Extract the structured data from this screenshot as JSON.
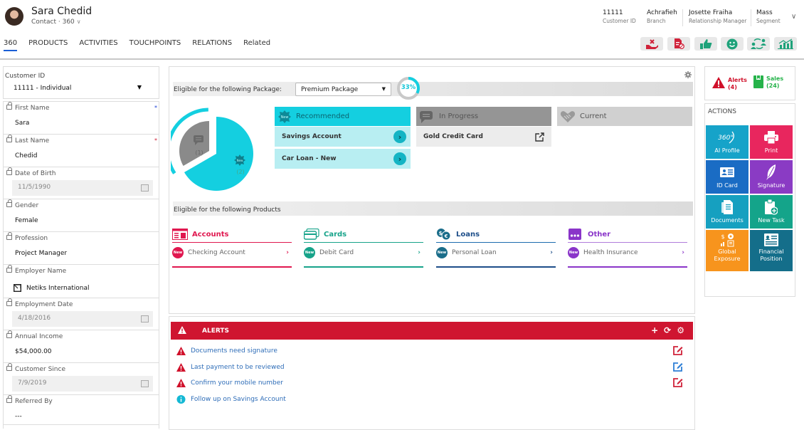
{
  "header": {
    "name": "Sara Chedid",
    "subtitle": "Contact · 360",
    "tabs": [
      "360",
      "PRODUCTS",
      "ACTIVITIES",
      "TOUCHPOINTS",
      "RELATIONS",
      "Related"
    ],
    "active_tab": "360",
    "fields": [
      {
        "value": "11111",
        "label": "Customer ID"
      },
      {
        "value": "Achrafieh",
        "label": "Branch"
      },
      {
        "value": "Josette Fraiha",
        "label": "Relationship Manager"
      },
      {
        "value": "Mass",
        "label": "Segment"
      }
    ],
    "quick_actions": [
      {
        "icon": "hand-cancel-icon",
        "color": "#d0223a"
      },
      {
        "icon": "document-blocked-icon",
        "color": "#d0223a"
      },
      {
        "icon": "thumbs-up-icon",
        "color": "#1ea27a"
      },
      {
        "icon": "smiley-icon",
        "color": "#1ea27a"
      },
      {
        "icon": "people-exchange-icon",
        "color": "#1ea27a"
      },
      {
        "icon": "growth-chart-icon",
        "color": "#1ea27a"
      }
    ]
  },
  "left": {
    "customer_id_label": "Customer ID",
    "customer_id_value": "11111 - Individual",
    "fields": [
      {
        "label": "First Name",
        "value": "Sara",
        "type": "text",
        "required": "blue"
      },
      {
        "label": "Last Name",
        "value": "Chedid",
        "type": "text",
        "required": "red"
      },
      {
        "label": "Date of Birth",
        "value": "11/5/1990",
        "type": "date"
      },
      {
        "label": "Gender",
        "value": "Female",
        "type": "text"
      },
      {
        "label": "Profession",
        "value": "Project Manager",
        "type": "text"
      },
      {
        "label": "Employer Name",
        "value": "Netiks International",
        "type": "lookup"
      },
      {
        "label": "Employment Date",
        "value": "4/18/2016",
        "type": "date"
      },
      {
        "label": "Annual Income",
        "value": "$54,000.00",
        "type": "text"
      },
      {
        "label": "Customer Since",
        "value": "7/9/2019",
        "type": "date"
      },
      {
        "label": "Referred By",
        "value": "---",
        "type": "text"
      }
    ]
  },
  "package": {
    "label": "Eligible for the following Package:",
    "selected": "Premium Package",
    "progress_percent": 33,
    "progress_text": "33%",
    "donut": [
      {
        "label": "(1)",
        "count": 1,
        "status": "In Progress"
      },
      {
        "label": "(2)",
        "count": 2,
        "status": "Recommended"
      }
    ],
    "columns": {
      "recommended": {
        "title": "Recommended",
        "items": [
          "Savings Account",
          "Car Loan - New"
        ]
      },
      "in_progress": {
        "title": "In Progress",
        "items": [
          "Gold Credit Card"
        ]
      },
      "current": {
        "title": "Current",
        "items": []
      }
    }
  },
  "products": {
    "label": "Eligible for the following Products",
    "categories": [
      {
        "name": "Accounts",
        "item": "Checking Account",
        "color": "#e0174f"
      },
      {
        "name": "Cards",
        "item": "Debit Card",
        "color": "#17a38a"
      },
      {
        "name": "Loans",
        "item": "Personal Loan",
        "color": "#1d4e89"
      },
      {
        "name": "Other",
        "item": "Health Insurance",
        "color": "#8a35c9"
      }
    ],
    "badge": "New"
  },
  "alerts": {
    "title": "ALERTS",
    "items": [
      {
        "text": "Documents need signature",
        "type": "warning",
        "edit_color": "#d0223a"
      },
      {
        "text": "Last payment to be reviewed",
        "type": "warning",
        "edit_color": "#2e7fd6"
      },
      {
        "text": "Confirm your mobile number",
        "type": "warning",
        "edit_color": "#d0223a"
      },
      {
        "text": "Follow up on Savings Account",
        "type": "info",
        "edit_color": null
      }
    ]
  },
  "summary": {
    "alerts_label": "Alerts",
    "alerts_count": "(4)",
    "sales_label": "Sales",
    "sales_count": "(24)"
  },
  "actions": {
    "title": "ACTIONS",
    "items": [
      {
        "label": "AI Profile",
        "color": "#16a3c9"
      },
      {
        "label": "Print",
        "color": "#e8265e"
      },
      {
        "label": "ID Card",
        "color": "#1a6cc4"
      },
      {
        "label": "Signature",
        "color": "#8a3bc4"
      },
      {
        "label": "Documents",
        "color": "#16a0c0"
      },
      {
        "label": "New Task",
        "color": "#14a48a"
      },
      {
        "label": "Global Exposure",
        "color": "#f7941d"
      },
      {
        "label": "Financial Position",
        "color": "#146e8a"
      }
    ]
  }
}
